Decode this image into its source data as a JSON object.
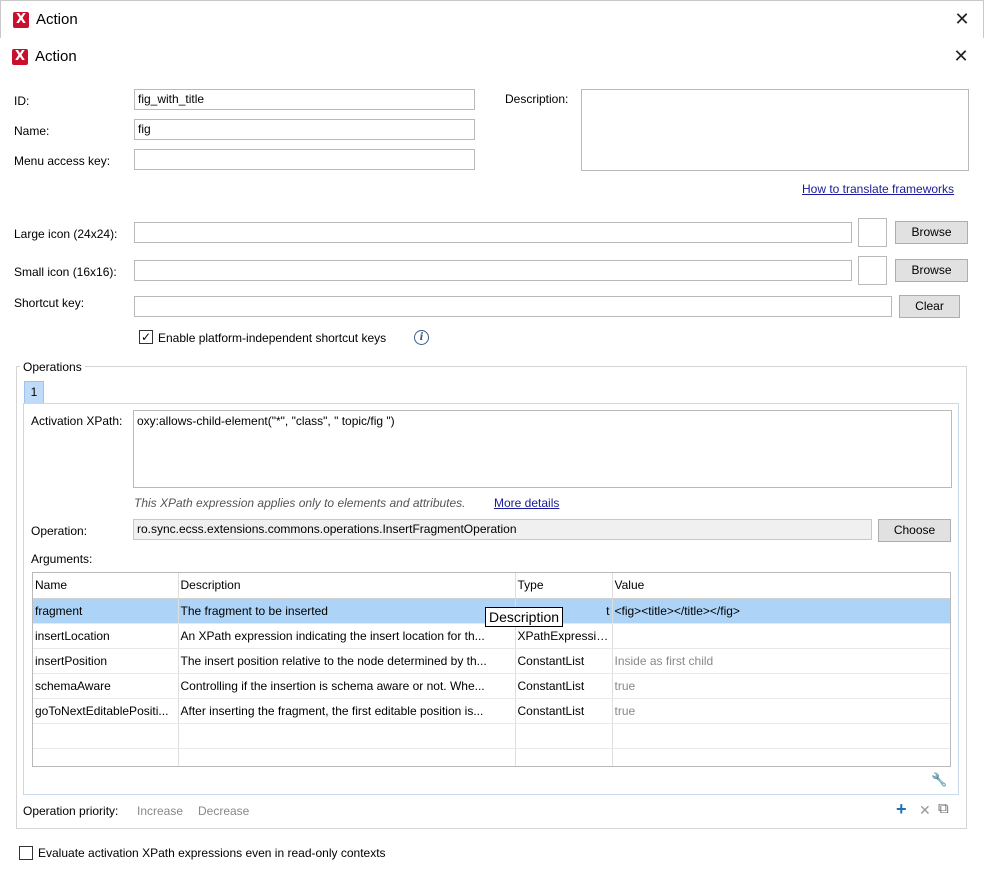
{
  "window": {
    "outer_title": "Action",
    "inner_title": "Action",
    "app_icon_glyph": "X"
  },
  "form": {
    "id_label": "ID:",
    "id_value": "fig_with_title",
    "name_label": "Name:",
    "name_value": "fig",
    "menu_key_label": "Menu access key:",
    "menu_key_value": "",
    "description_label": "Description:",
    "description_value": "",
    "translate_link": "How to translate frameworks",
    "large_icon_label": "Large icon (24x24):",
    "large_icon_value": "",
    "small_icon_label": "Small icon (16x16):",
    "small_icon_value": "",
    "browse_label": "Browse",
    "shortcut_label": "Shortcut key:",
    "shortcut_value": "",
    "clear_label": "Clear",
    "platform_checkbox_label": "Enable platform-independent shortcut keys",
    "platform_checked": true,
    "check_glyph": "✓",
    "info_glyph": "i"
  },
  "operations": {
    "group_label": "Operations",
    "tab_label": "1",
    "activation_label": "Activation XPath:",
    "activation_value": "oxy:allows-child-element(\"*\", \"class\", \" topic/fig \")",
    "xpath_note": "This XPath expression applies only to elements and attributes.",
    "more_details": "More details",
    "operation_label": "Operation:",
    "operation_value": "ro.sync.ecss.extensions.commons.operations.InsertFragmentOperation",
    "choose_label": "Choose",
    "arguments_label": "Arguments:",
    "columns": [
      "Name",
      "Description",
      "Type",
      "Value"
    ],
    "rows": [
      {
        "name": "fragment",
        "description": "The fragment to be inserted",
        "type": "t",
        "value": "<fig><title></title></fig>",
        "value_gray": false,
        "selected": true
      },
      {
        "name": "insertLocation",
        "description": "An XPath expression indicating the insert location for th...",
        "type": "XPathExpression",
        "value": "",
        "value_gray": false,
        "selected": false
      },
      {
        "name": "insertPosition",
        "description": "The insert position relative to the node determined by th...",
        "type": "ConstantList",
        "value": "Inside as first child",
        "value_gray": true,
        "selected": false
      },
      {
        "name": "schemaAware",
        "description": "Controlling if the insertion is schema aware or not. Whe...",
        "type": "ConstantList",
        "value": "true",
        "value_gray": true,
        "selected": false
      },
      {
        "name": "goToNextEditablePositi...",
        "description": "After inserting the fragment, the first editable position is...",
        "type": "ConstantList",
        "value": "true",
        "value_gray": true,
        "selected": false
      }
    ],
    "tooltip": "Description",
    "wrench_glyph": "🔧",
    "priority_label": "Operation priority:",
    "increase_label": "Increase",
    "decrease_label": "Decrease",
    "add_glyph": "+",
    "remove_glyph": "✕",
    "copy_glyph": "⧉"
  },
  "footer": {
    "readonly_label": "Evaluate activation XPath expressions even in read-only contexts",
    "readonly_checked": false
  },
  "colors": {
    "selection": "#add3f7",
    "link": "#1a1a9c",
    "tab": "#bfdbf7",
    "add_icon": "#1f6fb5"
  }
}
